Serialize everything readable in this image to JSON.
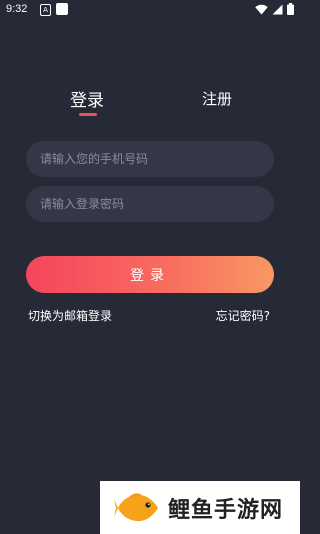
{
  "status_bar": {
    "time": "9:32",
    "icons": [
      "android-notification-icon",
      "square-notification-icon",
      "wifi-icon",
      "signal-icon",
      "battery-icon"
    ]
  },
  "tabs": {
    "login": "登录",
    "register": "注册",
    "active": "login"
  },
  "form": {
    "phone_placeholder": "请输入您的手机号码",
    "password_placeholder": "请输入登录密码"
  },
  "actions": {
    "login_button": "登录",
    "email_login_link": "切换为邮箱登录",
    "forgot_password_link": "忘记密码?"
  },
  "watermark": {
    "text": "鲤鱼手游网"
  },
  "colors": {
    "background": "#262936",
    "input_background": "#343846",
    "accent": "#ee4d5a",
    "button_gradient_start": "#f5455d",
    "button_gradient_end": "#f99862"
  }
}
